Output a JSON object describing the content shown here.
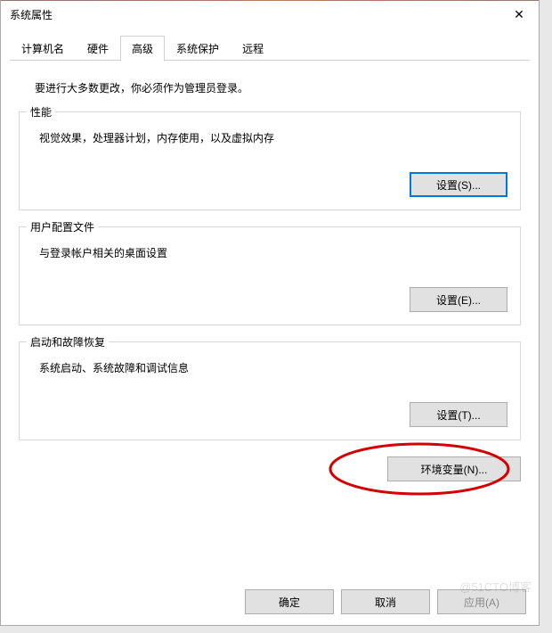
{
  "window": {
    "title": "系统属性",
    "close_glyph": "✕"
  },
  "tabs": {
    "computer_name": "计算机名",
    "hardware": "硬件",
    "advanced": "高级",
    "system_protection": "系统保护",
    "remote": "远程"
  },
  "intro": "要进行大多数更改，你必须作为管理员登录。",
  "groups": {
    "performance": {
      "title": "性能",
      "desc": "视觉效果，处理器计划，内存使用，以及虚拟内存",
      "button": "设置(S)..."
    },
    "user_profiles": {
      "title": "用户配置文件",
      "desc": "与登录帐户相关的桌面设置",
      "button": "设置(E)..."
    },
    "startup_recovery": {
      "title": "启动和故障恢复",
      "desc": "系统启动、系统故障和调试信息",
      "button": "设置(T)..."
    }
  },
  "env_button": "环境变量(N)...",
  "bottom": {
    "ok": "确定",
    "cancel": "取消",
    "apply": "应用(A)"
  },
  "watermark": "@51CTO博客"
}
